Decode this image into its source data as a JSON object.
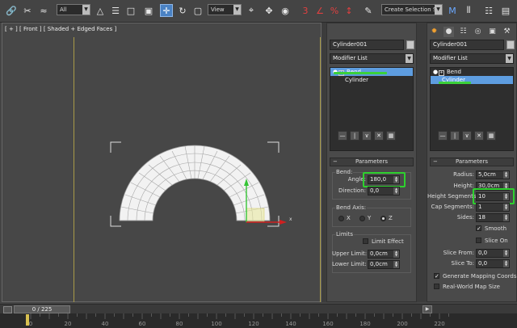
{
  "toolbar": {
    "filter_select": "All",
    "coord_select": "View",
    "selection_set": "Create Selection Se",
    "snap_label": "3",
    "percent_snap": "%"
  },
  "viewport": {
    "label": "[ + ] [ Front ] [ Shaded + Edged Faces ]"
  },
  "bend_panel": {
    "object_name": "Cylinder001",
    "modifier_list": "Modifier List",
    "stack": [
      "Bend",
      "Cylinder"
    ],
    "rollout_title": "Parameters",
    "group_bend": "Bend:",
    "angle_label": "Angle:",
    "angle_value": "180,0",
    "direction_label": "Direction:",
    "direction_value": "0,0",
    "group_axis": "Bend Axis:",
    "axis_x": "X",
    "axis_y": "Y",
    "axis_z": "Z",
    "axis_selected": "Z",
    "group_limits": "Limits",
    "limit_effect": "Limit Effect",
    "upper_label": "Upper Limit:",
    "upper_value": "0,0cm",
    "lower_label": "Lower Limit:",
    "lower_value": "0,0cm"
  },
  "cyl_panel": {
    "object_name": "Cylinder001",
    "modifier_list": "Modifier List",
    "stack": [
      "Bend",
      "Cylinder"
    ],
    "rollout_title": "Parameters",
    "radius_label": "Radius:",
    "radius_value": "5,0cm",
    "height_label": "Height:",
    "height_value": "30,0cm",
    "height_seg_label": "Height Segments:",
    "height_seg_value": "10",
    "cap_seg_label": "Cap Segments:",
    "cap_seg_value": "1",
    "sides_label": "Sides:",
    "sides_value": "18",
    "smooth_label": "Smooth",
    "smooth_checked": true,
    "slice_on_label": "Slice On",
    "slice_on_checked": false,
    "slice_from_label": "Slice From:",
    "slice_from_value": "0,0",
    "slice_to_label": "Slice To:",
    "slice_to_value": "0,0",
    "gen_map_label": "Generate Mapping Coords.",
    "gen_map_checked": true,
    "real_world_label": "Real-World Map Size",
    "real_world_checked": false
  },
  "timeline": {
    "frame_counter": "0 / 225",
    "ticks": [
      "0",
      "20",
      "40",
      "60",
      "80",
      "100",
      "120",
      "140",
      "160",
      "180",
      "200",
      "220"
    ]
  },
  "colors": {
    "highlight": "#2ed12e",
    "selected_row": "#5e9de0",
    "safe_frame": "#a89a48"
  }
}
